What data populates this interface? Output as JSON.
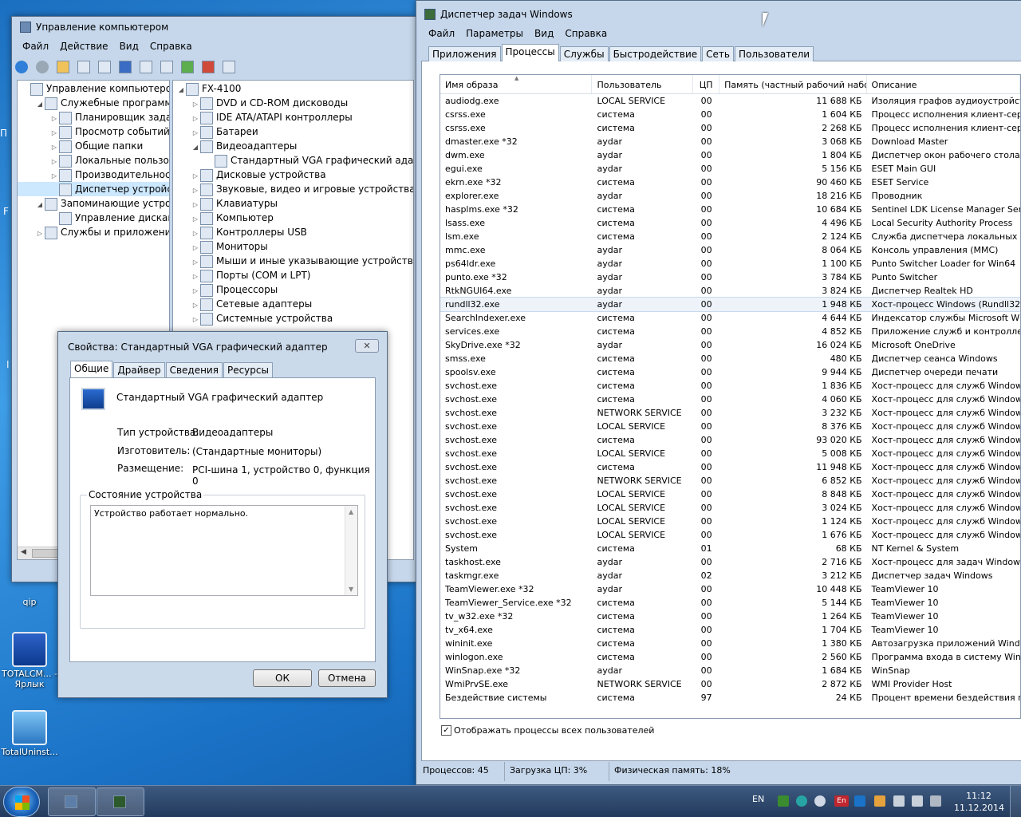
{
  "desktop": {
    "icons": [
      {
        "label": "qip"
      },
      {
        "label": "TOTALCM... - Ярлык"
      },
      {
        "label": "TotalUninst..."
      }
    ]
  },
  "computer_management": {
    "title": "Управление компьютером",
    "menu": [
      "Файл",
      "Действие",
      "Вид",
      "Справка"
    ],
    "left_tree": [
      {
        "label": "Управление компьютером (л",
        "level": 0,
        "expander": ""
      },
      {
        "label": "Служебные программы",
        "level": 1,
        "expander": "◢"
      },
      {
        "label": "Планировщик заданий",
        "level": 2,
        "expander": "▷"
      },
      {
        "label": "Просмотр событий",
        "level": 2,
        "expander": "▷"
      },
      {
        "label": "Общие папки",
        "level": 2,
        "expander": "▷"
      },
      {
        "label": "Локальные пользовате",
        "level": 2,
        "expander": "▷"
      },
      {
        "label": "Производительность",
        "level": 2,
        "expander": "▷"
      },
      {
        "label": "Диспетчер устройств",
        "level": 2,
        "expander": "",
        "selected": true
      },
      {
        "label": "Запоминающие устройст",
        "level": 1,
        "expander": "◢"
      },
      {
        "label": "Управление дисками",
        "level": 2,
        "expander": ""
      },
      {
        "label": "Службы и приложения",
        "level": 1,
        "expander": "▷"
      }
    ],
    "device_tree": [
      {
        "label": "FX-4100",
        "level": 0,
        "expander": "◢"
      },
      {
        "label": "DVD и CD-ROM дисководы",
        "level": 1,
        "expander": "▷"
      },
      {
        "label": "IDE ATA/ATAPI контроллеры",
        "level": 1,
        "expander": "▷"
      },
      {
        "label": "Батареи",
        "level": 1,
        "expander": "▷"
      },
      {
        "label": "Видеоадаптеры",
        "level": 1,
        "expander": "◢"
      },
      {
        "label": "Стандартный VGA графический адаптер",
        "level": 2,
        "expander": ""
      },
      {
        "label": "Дисковые устройства",
        "level": 1,
        "expander": "▷"
      },
      {
        "label": "Звуковые, видео и игровые устройства",
        "level": 1,
        "expander": "▷"
      },
      {
        "label": "Клавиатуры",
        "level": 1,
        "expander": "▷"
      },
      {
        "label": "Компьютер",
        "level": 1,
        "expander": "▷"
      },
      {
        "label": "Контроллеры USB",
        "level": 1,
        "expander": "▷"
      },
      {
        "label": "Мониторы",
        "level": 1,
        "expander": "▷"
      },
      {
        "label": "Мыши и иные указывающие устройства",
        "level": 1,
        "expander": "▷"
      },
      {
        "label": "Порты (COM и LPT)",
        "level": 1,
        "expander": "▷"
      },
      {
        "label": "Процессоры",
        "level": 1,
        "expander": "▷"
      },
      {
        "label": "Сетевые адаптеры",
        "level": 1,
        "expander": "▷"
      },
      {
        "label": "Системные устройства",
        "level": 1,
        "expander": "▷"
      }
    ]
  },
  "properties": {
    "title": "Свойства: Стандартный VGA графический адаптер",
    "tabs": [
      "Общие",
      "Драйвер",
      "Сведения",
      "Ресурсы"
    ],
    "device_name": "Стандартный VGA графический адаптер",
    "fields": [
      {
        "label": "Тип устройства:",
        "value": "Видеоадаптеры"
      },
      {
        "label": "Изготовитель:",
        "value": "(Стандартные мониторы)"
      },
      {
        "label": "Размещение:",
        "value": "PCI-шина 1, устройство 0, функция 0"
      }
    ],
    "status_group": "Состояние устройства",
    "status_text": "Устройство работает нормально.",
    "ok": "ОК",
    "cancel": "Отмена"
  },
  "task_manager": {
    "title": "Диспетчер задач Windows",
    "menu": [
      "Файл",
      "Параметры",
      "Вид",
      "Справка"
    ],
    "tabs": [
      "Приложения",
      "Процессы",
      "Службы",
      "Быстродействие",
      "Сеть",
      "Пользователи"
    ],
    "selected_tab": 1,
    "columns": [
      "Имя образа",
      "Пользователь",
      "ЦП",
      "Память (частный рабочий набор)",
      "Описание"
    ],
    "rows": [
      [
        "audiodg.exe",
        "LOCAL SERVICE",
        "00",
        "11 688 КБ",
        "Изоляция графов аудиоустройств W"
      ],
      [
        "csrss.exe",
        "система",
        "00",
        "1 604 КБ",
        "Процесс исполнения клиент-сервер"
      ],
      [
        "csrss.exe",
        "система",
        "00",
        "2 268 КБ",
        "Процесс исполнения клиент-сервер"
      ],
      [
        "dmaster.exe *32",
        "aydar",
        "00",
        "3 068 КБ",
        "Download Master"
      ],
      [
        "dwm.exe",
        "aydar",
        "00",
        "1 804 КБ",
        "Диспетчер окон рабочего стола"
      ],
      [
        "egui.exe",
        "aydar",
        "00",
        "5 156 КБ",
        "ESET Main GUI"
      ],
      [
        "ekrn.exe *32",
        "система",
        "00",
        "90 460 КБ",
        "ESET Service"
      ],
      [
        "explorer.exe",
        "aydar",
        "00",
        "18 216 КБ",
        "Проводник"
      ],
      [
        "hasplms.exe *32",
        "система",
        "00",
        "10 684 КБ",
        "Sentinel LDK License Manager Service"
      ],
      [
        "lsass.exe",
        "система",
        "00",
        "4 496 КБ",
        "Local Security Authority Process"
      ],
      [
        "lsm.exe",
        "система",
        "00",
        "2 124 КБ",
        "Служба диспетчера локальных сеан"
      ],
      [
        "mmc.exe",
        "aydar",
        "00",
        "8 064 КБ",
        "Консоль управления (MMC)"
      ],
      [
        "ps64ldr.exe",
        "aydar",
        "00",
        "1 100 КБ",
        "Punto Switcher Loader for Win64"
      ],
      [
        "punto.exe *32",
        "aydar",
        "00",
        "3 784 КБ",
        "Punto Switcher"
      ],
      [
        "RtkNGUI64.exe",
        "aydar",
        "00",
        "3 824 КБ",
        "Диспетчер Realtek HD"
      ],
      [
        "rundll32.exe",
        "aydar",
        "00",
        "1 948 КБ",
        "Хост-процесс Windows (Rundll32)"
      ],
      [
        "SearchIndexer.exe",
        "система",
        "00",
        "4 644 КБ",
        "Индексатор службы Microsoft Windo"
      ],
      [
        "services.exe",
        "система",
        "00",
        "4 852 КБ",
        "Приложение служб и контроллеров"
      ],
      [
        "SkyDrive.exe *32",
        "aydar",
        "00",
        "16 024 КБ",
        "Microsoft OneDrive"
      ],
      [
        "smss.exe",
        "система",
        "00",
        "480 КБ",
        "Диспетчер сеанса  Windows"
      ],
      [
        "spoolsv.exe",
        "система",
        "00",
        "9 944 КБ",
        "Диспетчер очереди печати"
      ],
      [
        "svchost.exe",
        "система",
        "00",
        "1 836 КБ",
        "Хост-процесс для служб Windows"
      ],
      [
        "svchost.exe",
        "система",
        "00",
        "4 060 КБ",
        "Хост-процесс для служб Windows"
      ],
      [
        "svchost.exe",
        "NETWORK SERVICE",
        "00",
        "3 232 КБ",
        "Хост-процесс для служб Windows"
      ],
      [
        "svchost.exe",
        "LOCAL SERVICE",
        "00",
        "8 376 КБ",
        "Хост-процесс для служб Windows"
      ],
      [
        "svchost.exe",
        "система",
        "00",
        "93 020 КБ",
        "Хост-процесс для служб Windows"
      ],
      [
        "svchost.exe",
        "LOCAL SERVICE",
        "00",
        "5 008 КБ",
        "Хост-процесс для служб Windows"
      ],
      [
        "svchost.exe",
        "система",
        "00",
        "11 948 КБ",
        "Хост-процесс для служб Windows"
      ],
      [
        "svchost.exe",
        "NETWORK SERVICE",
        "00",
        "6 852 КБ",
        "Хост-процесс для служб Windows"
      ],
      [
        "svchost.exe",
        "LOCAL SERVICE",
        "00",
        "8 848 КБ",
        "Хост-процесс для служб Windows"
      ],
      [
        "svchost.exe",
        "LOCAL SERVICE",
        "00",
        "3 024 КБ",
        "Хост-процесс для служб Windows"
      ],
      [
        "svchost.exe",
        "LOCAL SERVICE",
        "00",
        "1 124 КБ",
        "Хост-процесс для служб Windows"
      ],
      [
        "svchost.exe",
        "LOCAL SERVICE",
        "00",
        "1 676 КБ",
        "Хост-процесс для служб Windows"
      ],
      [
        "System",
        "система",
        "01",
        "68 КБ",
        "NT Kernel & System"
      ],
      [
        "taskhost.exe",
        "aydar",
        "00",
        "2 716 КБ",
        "Хост-процесс для задач Windows"
      ],
      [
        "taskmgr.exe",
        "aydar",
        "02",
        "3 212 КБ",
        "Диспетчер задач Windows"
      ],
      [
        "TeamViewer.exe *32",
        "aydar",
        "00",
        "10 448 КБ",
        "TeamViewer 10"
      ],
      [
        "TeamViewer_Service.exe *32",
        "система",
        "00",
        "5 144 КБ",
        "TeamViewer 10"
      ],
      [
        "tv_w32.exe *32",
        "система",
        "00",
        "1 264 КБ",
        "TeamViewer 10"
      ],
      [
        "tv_x64.exe",
        "система",
        "00",
        "1 704 КБ",
        "TeamViewer 10"
      ],
      [
        "wininit.exe",
        "система",
        "00",
        "1 380 КБ",
        "Автозагрузка приложений Windows"
      ],
      [
        "winlogon.exe",
        "система",
        "00",
        "2 560 КБ",
        "Программа входа в систему Windows"
      ],
      [
        "WinSnap.exe *32",
        "aydar",
        "00",
        "1 684 КБ",
        "WinSnap"
      ],
      [
        "WmiPrvSE.exe",
        "NETWORK SERVICE",
        "00",
        "2 872 КБ",
        "WMI Provider Host"
      ],
      [
        "Бездействие системы",
        "система",
        "97",
        "24 КБ",
        "Процент времени бездействия проце"
      ]
    ],
    "selected_row": 15,
    "show_all_label": "Отображать процессы всех пользователей",
    "status": {
      "processes": "Процессов: 45",
      "cpu": "Загрузка ЦП: 3%",
      "memory": "Физическая память: 18%"
    }
  },
  "taskbar": {
    "lang": "EN",
    "time": "11:12",
    "date": "11.12.2014"
  },
  "colors": {
    "accent": "#3399ff",
    "window_frame": "#c6d7eb",
    "taskbar": "#2b4366"
  }
}
